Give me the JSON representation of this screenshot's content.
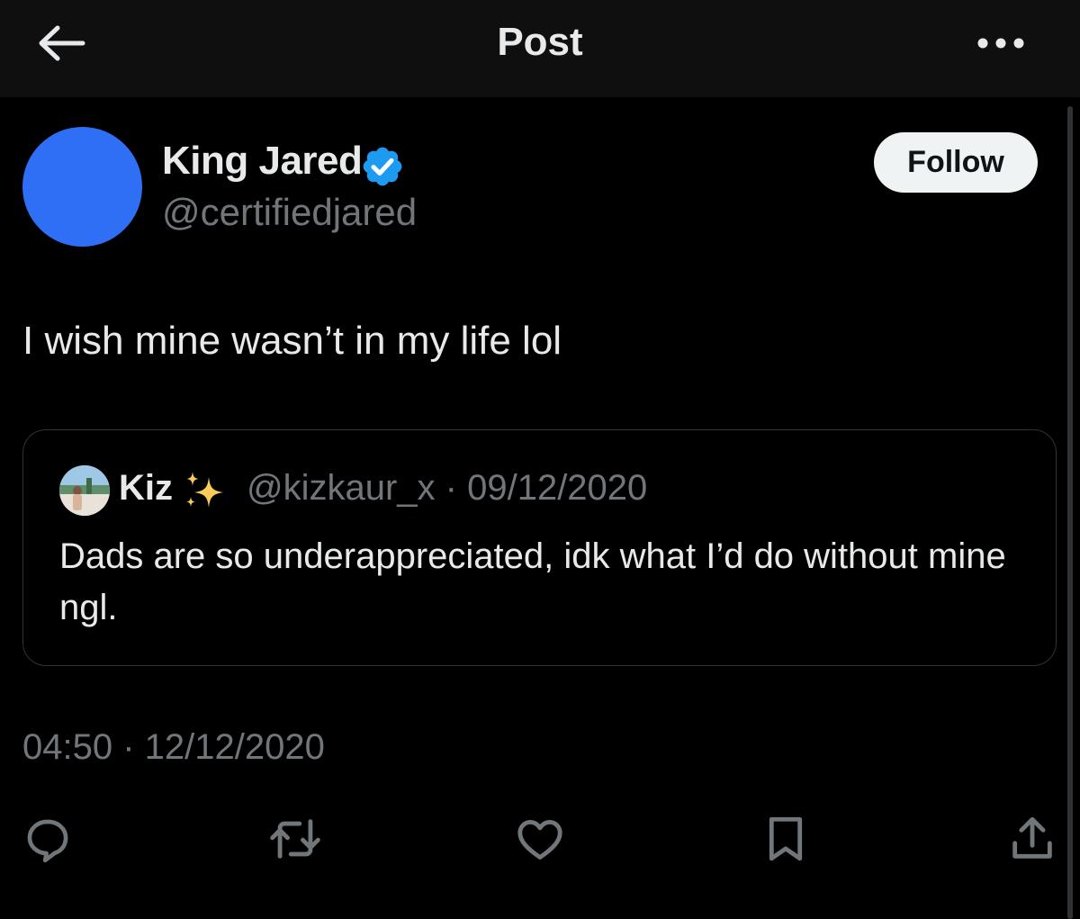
{
  "header": {
    "title": "Post",
    "back_icon": "arrow-left-icon",
    "more_icon": "more-horizontal-icon"
  },
  "author": {
    "display_name": "King Jared",
    "handle": "@certifiedjared",
    "verified": true,
    "avatar_color": "#2f6ff6",
    "follow_label": "Follow"
  },
  "post": {
    "text": "I wish mine wasn’t in my life lol",
    "timestamp": "04:50 · 12/12/2020"
  },
  "quoted_post": {
    "display_name": "Kiz",
    "emoji_icon": "sparkles-icon",
    "meta": "@kizkaur_x · 09/12/2020",
    "text": "Dads are so underappreciated, idk what I’d do without mine ngl."
  },
  "actions": [
    "reply-icon",
    "repost-icon",
    "like-icon",
    "bookmark-icon",
    "share-icon"
  ],
  "colors": {
    "background": "#000000",
    "header_background": "#0f0f10",
    "text_primary": "#e7e9ea",
    "text_secondary": "#71767b",
    "verified_blue": "#1d9bf0",
    "border": "#2f3336"
  }
}
